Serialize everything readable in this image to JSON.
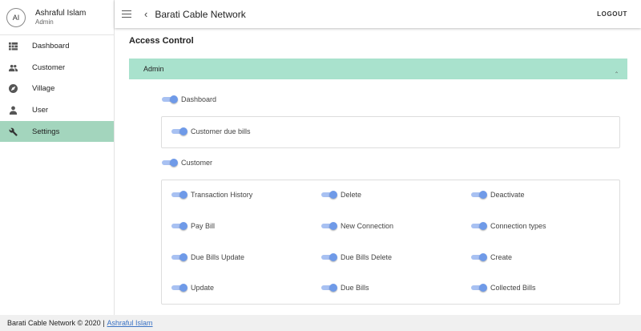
{
  "user": {
    "initials": "AI",
    "name": "Ashraful Islam",
    "role": "Admin"
  },
  "sidebar": {
    "items": [
      {
        "label": "Dashboard",
        "icon": "dashboard-icon"
      },
      {
        "label": "Customer",
        "icon": "people-icon"
      },
      {
        "label": "Village",
        "icon": "compass-icon"
      },
      {
        "label": "User",
        "icon": "person-icon"
      },
      {
        "label": "Settings",
        "icon": "wrench-icon",
        "active": true
      }
    ]
  },
  "header": {
    "title": "Barati Cable Network",
    "logout_label": "LOGOUT"
  },
  "page": {
    "title": "Access Control"
  },
  "panel": {
    "title": "Admin",
    "expanded": true
  },
  "permissions": {
    "dashboard": {
      "label": "Dashboard",
      "enabled": true
    },
    "customer_due_bills": {
      "label": "Customer due bills",
      "enabled": true
    },
    "customer": {
      "label": "Customer",
      "enabled": true
    },
    "customer_children": [
      {
        "label": "Transaction History",
        "enabled": true
      },
      {
        "label": "Delete",
        "enabled": true
      },
      {
        "label": "Deactivate",
        "enabled": true
      },
      {
        "label": "Pay Bill",
        "enabled": true
      },
      {
        "label": "New Connection",
        "enabled": true
      },
      {
        "label": "Connection types",
        "enabled": true
      },
      {
        "label": "Due Bills Update",
        "enabled": true
      },
      {
        "label": "Due Bills Delete",
        "enabled": true
      },
      {
        "label": "Create",
        "enabled": true
      },
      {
        "label": "Update",
        "enabled": true
      },
      {
        "label": "Due Bills",
        "enabled": true
      },
      {
        "label": "Collected Bills",
        "enabled": true
      }
    ]
  },
  "footer": {
    "text": "Barati Cable Network © 2020 |",
    "link_label": "Ashraful Islam"
  },
  "colors": {
    "accent": "#a3d5bd",
    "panel": "#a9e2cd",
    "toggle": "#6f9ae8",
    "link": "#3b73c5"
  }
}
